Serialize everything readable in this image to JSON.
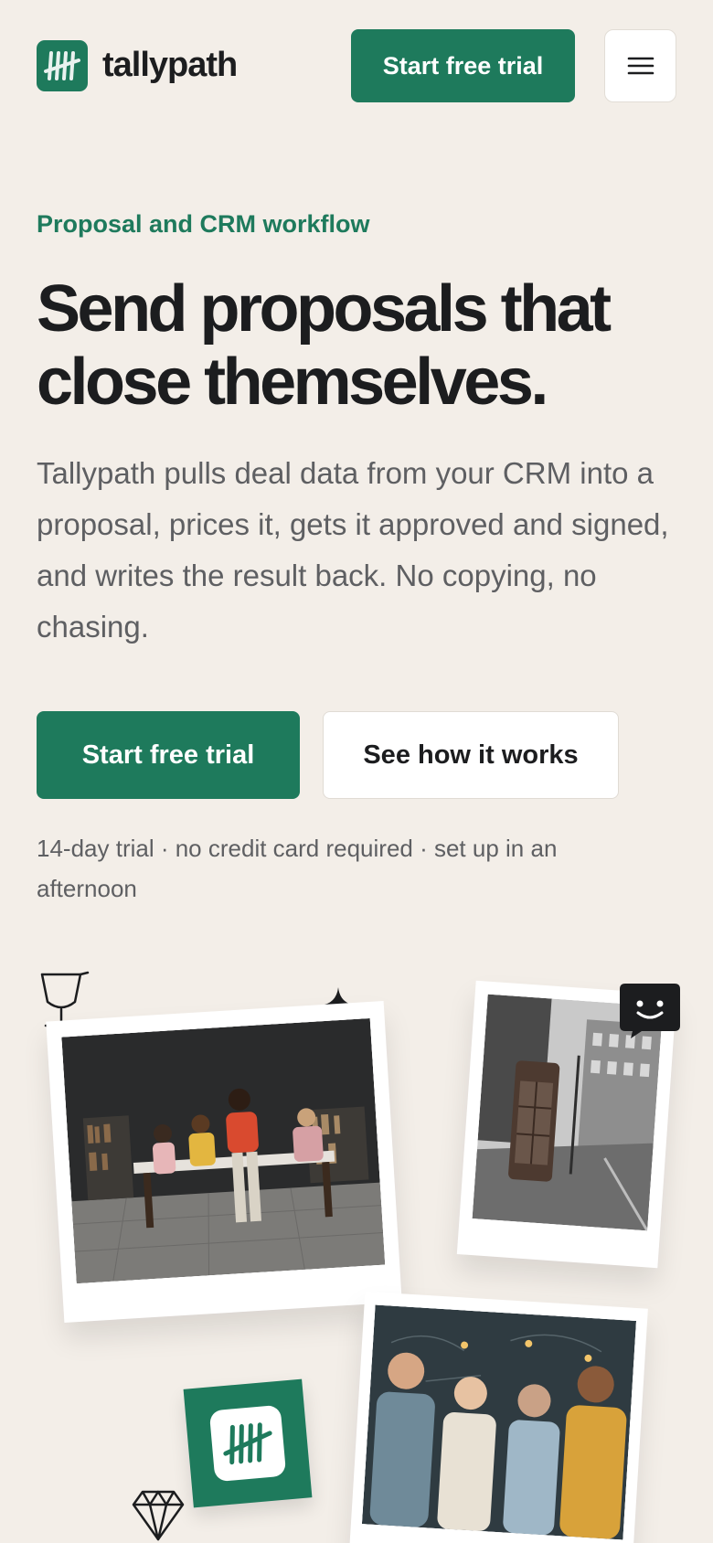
{
  "header": {
    "logo_text": "tallypath",
    "cta_label": "Start free trial",
    "menu_icon": "hamburger-menu-icon"
  },
  "hero": {
    "eyebrow": "Proposal and CRM workflow",
    "headline_line1": "Send proposals that",
    "headline_line2": "close themselves.",
    "description": "Tallypath pulls deal data from your CRM into a proposal, prices it, gets it approved and signed, and writes the result back. No copying, no chasing.",
    "primary_cta": "Start free trial",
    "secondary_cta": "See how it works",
    "fine_print": "14-day trial · no credit card required · set up in an afternoon"
  },
  "collage": {
    "photos": [
      {
        "name": "team-meeting-photo"
      },
      {
        "name": "london-phone-booth-photo"
      },
      {
        "name": "team-portrait-photo"
      }
    ],
    "doodles": [
      "cup-icon",
      "sparkle-icon",
      "chat-smiley-icon",
      "diamond-icon"
    ]
  },
  "colors": {
    "brand": "#1e7a5c",
    "background": "#f3eee8",
    "text": "#1c1d1f",
    "muted": "#5e5f62"
  }
}
